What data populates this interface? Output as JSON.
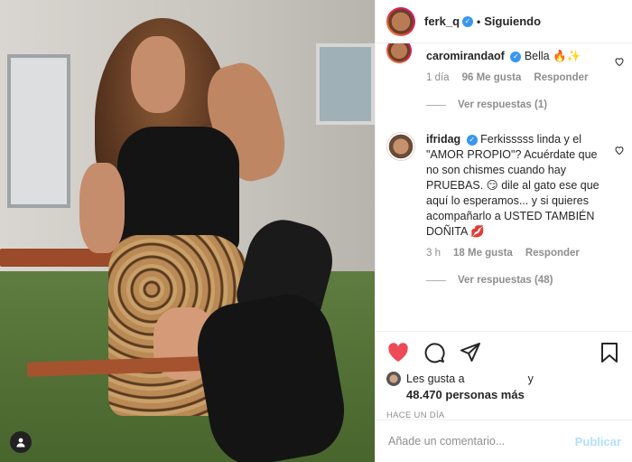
{
  "header": {
    "username": "ferk_q",
    "follow_label": "Siguiendo",
    "dot": "•"
  },
  "comments": [
    {
      "user": "caromirandaof",
      "text": "Bella 🔥✨",
      "time": "1 día",
      "likes": "96 Me gusta",
      "reply_label": "Responder",
      "view_replies": "Ver respuestas (1)"
    },
    {
      "user": "ifridag",
      "text": "Ferkisssss linda y el \"AMOR PROPIO\"? Acuérdate que no son chismes cuando hay PRUEBAS. 😏 dile al gato ese que aquí lo esperamos... y si quieres acompañarlo a USTED TAMBIÉN DOÑITA 💋",
      "time": "3 h",
      "likes": "18 Me gusta",
      "reply_label": "Responder",
      "view_replies": "Ver respuestas (48)"
    }
  ],
  "likes": {
    "prefix": "Les gusta a",
    "suffix": "y",
    "count": "48.470 personas más"
  },
  "timestamp": "HACE UN DÍA",
  "add_comment": {
    "placeholder": "Añade un comentario...",
    "publish_label": "Publicar"
  },
  "colors": {
    "like_red": "#ed4956",
    "verified_blue": "#3897f0",
    "publish_disabled": "#b2dffc"
  },
  "icons": [
    "heart-icon",
    "comment-icon",
    "share-icon",
    "bookmark-icon",
    "verified-icon",
    "user-tag-icon"
  ]
}
